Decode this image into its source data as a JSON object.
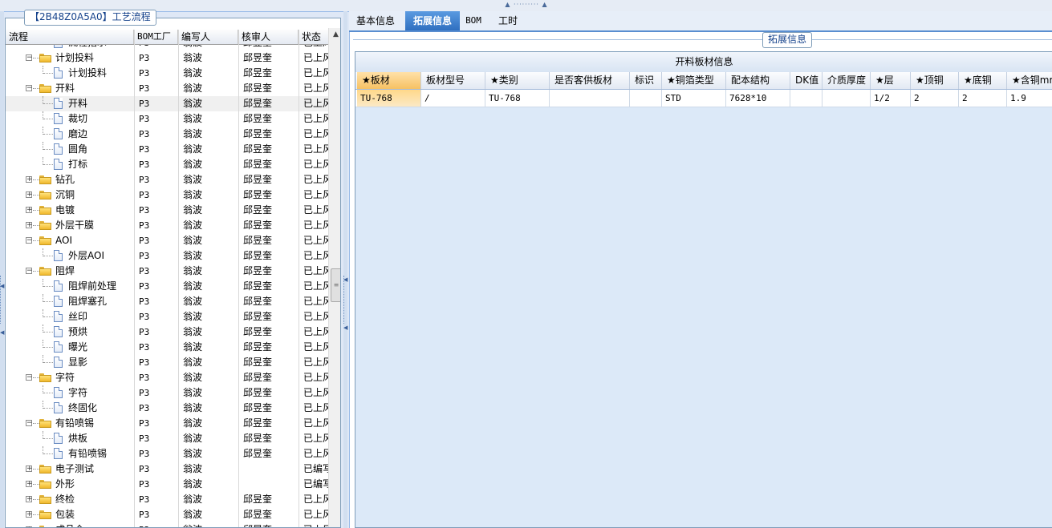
{
  "left_panel": {
    "title": "【2B48Z0A5A0】工艺流程",
    "columns": [
      "流程",
      "BOM工厂",
      "编写人",
      "核审人",
      "状态"
    ],
    "rows": [
      {
        "level": 1,
        "kind": "doc",
        "name": "流程指示",
        "factory": "P3",
        "author": "翁波",
        "reviewer": "邱昱奎",
        "status": "已上风"
      },
      {
        "level": 0,
        "kind": "folder",
        "expander": "−",
        "name": "计划投料",
        "factory": "P3",
        "author": "翁波",
        "reviewer": "邱昱奎",
        "status": "已上风"
      },
      {
        "level": 1,
        "kind": "doc",
        "name": "计划投料",
        "factory": "P3",
        "author": "翁波",
        "reviewer": "邱昱奎",
        "status": "已上风"
      },
      {
        "level": 0,
        "kind": "folder",
        "expander": "−",
        "name": "开料",
        "factory": "P3",
        "author": "翁波",
        "reviewer": "邱昱奎",
        "status": "已上风"
      },
      {
        "level": 1,
        "kind": "doc",
        "name": "开料",
        "factory": "P3",
        "author": "翁波",
        "reviewer": "邱昱奎",
        "status": "已上风",
        "selected": true
      },
      {
        "level": 1,
        "kind": "doc",
        "name": "裁切",
        "factory": "P3",
        "author": "翁波",
        "reviewer": "邱昱奎",
        "status": "已上风"
      },
      {
        "level": 1,
        "kind": "doc",
        "name": "磨边",
        "factory": "P3",
        "author": "翁波",
        "reviewer": "邱昱奎",
        "status": "已上风"
      },
      {
        "level": 1,
        "kind": "doc",
        "name": "圆角",
        "factory": "P3",
        "author": "翁波",
        "reviewer": "邱昱奎",
        "status": "已上风"
      },
      {
        "level": 1,
        "kind": "doc",
        "name": "打标",
        "factory": "P3",
        "author": "翁波",
        "reviewer": "邱昱奎",
        "status": "已上风"
      },
      {
        "level": 0,
        "kind": "folder",
        "expander": "+",
        "name": "钻孔",
        "factory": "P3",
        "author": "翁波",
        "reviewer": "邱昱奎",
        "status": "已上风"
      },
      {
        "level": 0,
        "kind": "folder",
        "expander": "+",
        "name": "沉铜",
        "factory": "P3",
        "author": "翁波",
        "reviewer": "邱昱奎",
        "status": "已上风"
      },
      {
        "level": 0,
        "kind": "folder",
        "expander": "+",
        "name": "电镀",
        "factory": "P3",
        "author": "翁波",
        "reviewer": "邱昱奎",
        "status": "已上风"
      },
      {
        "level": 0,
        "kind": "folder",
        "expander": "+",
        "name": "外层干膜",
        "factory": "P3",
        "author": "翁波",
        "reviewer": "邱昱奎",
        "status": "已上风"
      },
      {
        "level": 0,
        "kind": "folder",
        "expander": "−",
        "name": "AOI",
        "factory": "P3",
        "author": "翁波",
        "reviewer": "邱昱奎",
        "status": "已上风"
      },
      {
        "level": 1,
        "kind": "doc",
        "name": "外层AOI",
        "factory": "P3",
        "author": "翁波",
        "reviewer": "邱昱奎",
        "status": "已上风"
      },
      {
        "level": 0,
        "kind": "folder",
        "expander": "−",
        "name": "阻焊",
        "factory": "P3",
        "author": "翁波",
        "reviewer": "邱昱奎",
        "status": "已上风"
      },
      {
        "level": 1,
        "kind": "doc",
        "name": "阻焊前处理",
        "factory": "P3",
        "author": "翁波",
        "reviewer": "邱昱奎",
        "status": "已上风"
      },
      {
        "level": 1,
        "kind": "doc",
        "name": "阻焊塞孔",
        "factory": "P3",
        "author": "翁波",
        "reviewer": "邱昱奎",
        "status": "已上风"
      },
      {
        "level": 1,
        "kind": "doc",
        "name": "丝印",
        "factory": "P3",
        "author": "翁波",
        "reviewer": "邱昱奎",
        "status": "已上风"
      },
      {
        "level": 1,
        "kind": "doc",
        "name": "预烘",
        "factory": "P3",
        "author": "翁波",
        "reviewer": "邱昱奎",
        "status": "已上风"
      },
      {
        "level": 1,
        "kind": "doc",
        "name": "曝光",
        "factory": "P3",
        "author": "翁波",
        "reviewer": "邱昱奎",
        "status": "已上风"
      },
      {
        "level": 1,
        "kind": "doc",
        "name": "显影",
        "factory": "P3",
        "author": "翁波",
        "reviewer": "邱昱奎",
        "status": "已上风"
      },
      {
        "level": 0,
        "kind": "folder",
        "expander": "−",
        "name": "字符",
        "factory": "P3",
        "author": "翁波",
        "reviewer": "邱昱奎",
        "status": "已上风"
      },
      {
        "level": 1,
        "kind": "doc",
        "name": "字符",
        "factory": "P3",
        "author": "翁波",
        "reviewer": "邱昱奎",
        "status": "已上风"
      },
      {
        "level": 1,
        "kind": "doc",
        "name": "终固化",
        "factory": "P3",
        "author": "翁波",
        "reviewer": "邱昱奎",
        "status": "已上风"
      },
      {
        "level": 0,
        "kind": "folder",
        "expander": "−",
        "name": "有铅喷锡",
        "factory": "P3",
        "author": "翁波",
        "reviewer": "邱昱奎",
        "status": "已上风"
      },
      {
        "level": 1,
        "kind": "doc",
        "name": "烘板",
        "factory": "P3",
        "author": "翁波",
        "reviewer": "邱昱奎",
        "status": "已上风"
      },
      {
        "level": 1,
        "kind": "doc",
        "name": "有铅喷锡",
        "factory": "P3",
        "author": "翁波",
        "reviewer": "邱昱奎",
        "status": "已上风"
      },
      {
        "level": 0,
        "kind": "folder",
        "expander": "+",
        "name": "电子测试",
        "factory": "P3",
        "author": "翁波",
        "reviewer": "",
        "status": "已编写"
      },
      {
        "level": 0,
        "kind": "folder",
        "expander": "+",
        "name": "外形",
        "factory": "P3",
        "author": "翁波",
        "reviewer": "",
        "status": "已编写"
      },
      {
        "level": 0,
        "kind": "folder",
        "expander": "+",
        "name": "终检",
        "factory": "P3",
        "author": "翁波",
        "reviewer": "邱昱奎",
        "status": "已上风"
      },
      {
        "level": 0,
        "kind": "folder",
        "expander": "+",
        "name": "包装",
        "factory": "P3",
        "author": "翁波",
        "reviewer": "邱昱奎",
        "status": "已上风"
      },
      {
        "level": 0,
        "kind": "folder",
        "expander": "+",
        "name": "成品仓",
        "factory": "P3",
        "author": "翁波",
        "reviewer": "邱昱奎",
        "status": "已上风"
      }
    ]
  },
  "tabs": [
    {
      "label": "基本信息",
      "active": false
    },
    {
      "label": "拓展信息",
      "active": true
    },
    {
      "label": "BOM",
      "active": false
    },
    {
      "label": "工时",
      "active": false
    }
  ],
  "right_panel": {
    "legend": "拓展信息",
    "grid_title": "开料板材信息",
    "columns": [
      "★板材",
      "板材型号",
      "★类别",
      "是否客供板材",
      "标识",
      "★铜箔类型",
      "配本结构",
      "DK值",
      "介质厚度",
      "★层",
      "★顶铜",
      "★底铜",
      "★含铜mm"
    ],
    "rows": [
      [
        "TU-768",
        "/",
        "TU-768",
        "",
        "",
        "STD",
        "7628*10",
        "",
        "",
        "1/2",
        "2",
        "2",
        "1.9"
      ]
    ]
  },
  "colors": {
    "accent": "#2f6fc0",
    "highlight": "#f6c163",
    "panel_bg": "#dce9f8"
  }
}
